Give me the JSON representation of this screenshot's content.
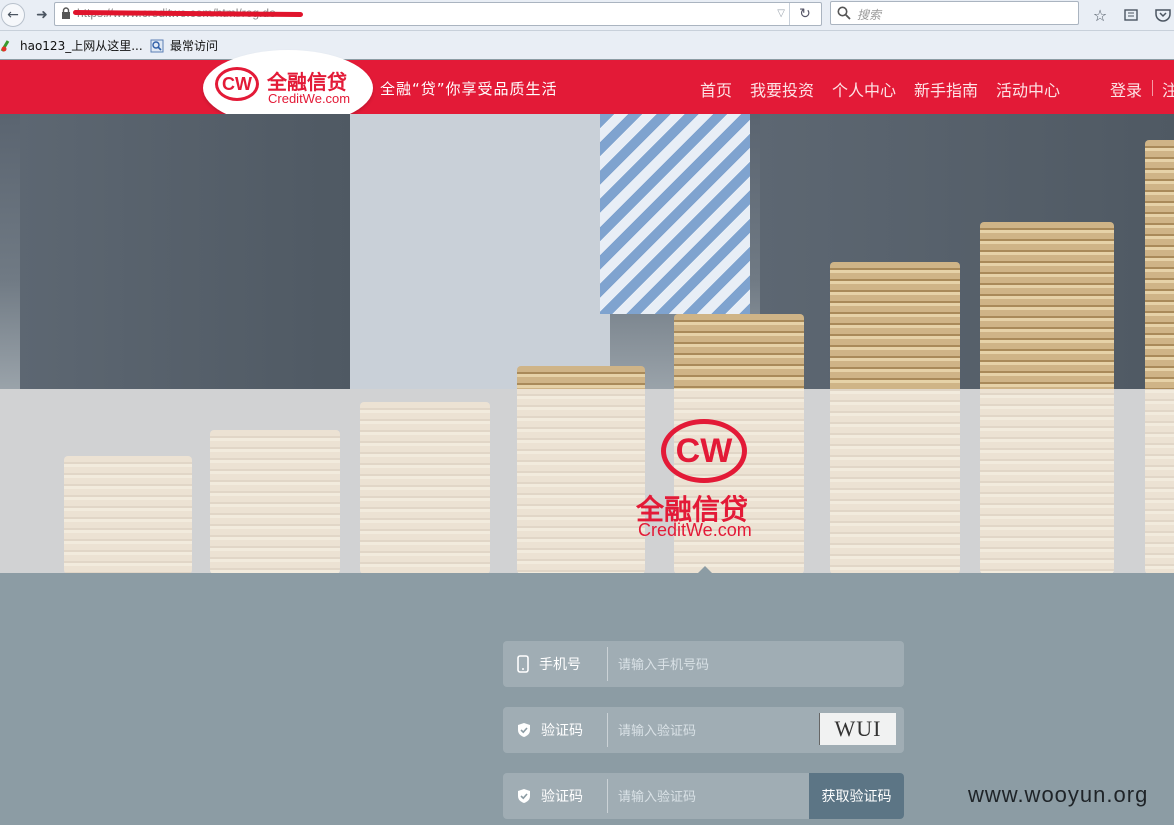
{
  "browser": {
    "url": "https://www.creditwe.com/html/reg.do",
    "search_placeholder": "搜索",
    "bookmarks": [
      {
        "label": "hao123_上网从这里..."
      },
      {
        "label": "最常访问"
      }
    ]
  },
  "site": {
    "logo_cn": "全融信贷",
    "logo_en": "CreditWe.com",
    "logo_mark": "CW",
    "slogan": "全融“贷”你享受品质生活",
    "nav": [
      "首页",
      "我要投资",
      "个人中心",
      "新手指南",
      "活动中心"
    ],
    "login": "登录",
    "register": "注",
    "brand_color": "#e31a37"
  },
  "form": {
    "phone": {
      "label": "手机号",
      "placeholder": "请输入手机号码",
      "icon": "phone-icon"
    },
    "captcha": {
      "label": "验证码",
      "placeholder": "请输入验证码",
      "icon": "shield-icon",
      "image_text": "WUI"
    },
    "sms": {
      "label": "验证码",
      "placeholder": "请输入验证码",
      "icon": "shield-icon",
      "button": "获取验证码"
    }
  },
  "watermark": "www.wooyun.org"
}
